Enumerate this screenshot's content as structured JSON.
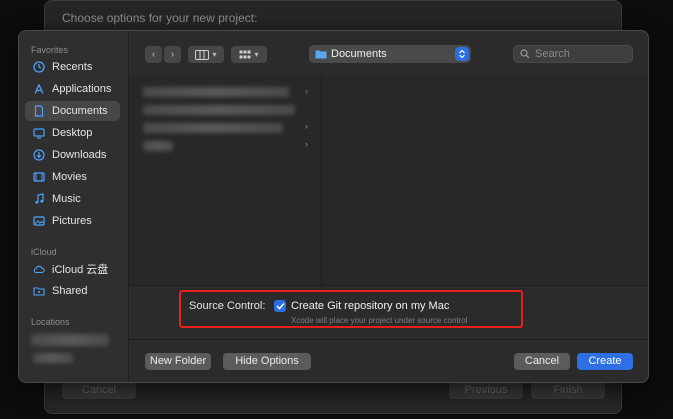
{
  "background_window": {
    "title": "Choose options for your new project:",
    "cancel_label": "Cancel",
    "previous_label": "Previous",
    "finish_label": "Finish"
  },
  "sidebar": {
    "favorites_label": "Favorites",
    "favorites": [
      {
        "label": "Recents",
        "icon": "clock-icon"
      },
      {
        "label": "Applications",
        "icon": "applications-icon"
      },
      {
        "label": "Documents",
        "icon": "document-icon",
        "selected": true
      },
      {
        "label": "Desktop",
        "icon": "desktop-icon"
      },
      {
        "label": "Downloads",
        "icon": "download-icon"
      },
      {
        "label": "Movies",
        "icon": "film-icon"
      },
      {
        "label": "Music",
        "icon": "music-note-icon"
      },
      {
        "label": "Pictures",
        "icon": "photo-icon"
      }
    ],
    "icloud_label": "iCloud",
    "icloud": [
      {
        "label": "iCloud 云盘",
        "icon": "cloud-icon"
      },
      {
        "label": "Shared",
        "icon": "shared-folder-icon"
      }
    ],
    "locations_label": "Locations"
  },
  "toolbar": {
    "location": "Documents",
    "search_placeholder": "Search"
  },
  "options": {
    "source_control_label": "Source Control:",
    "git_checkbox_label": "Create Git repository on my Mac",
    "git_checked": true,
    "git_hint": "Xcode will place your project under source control"
  },
  "buttons": {
    "new_folder": "New Folder",
    "hide_options": "Hide Options",
    "cancel": "Cancel",
    "create": "Create"
  },
  "colors": {
    "accent": "#2f6fe4",
    "highlight_box": "#e5201f"
  }
}
